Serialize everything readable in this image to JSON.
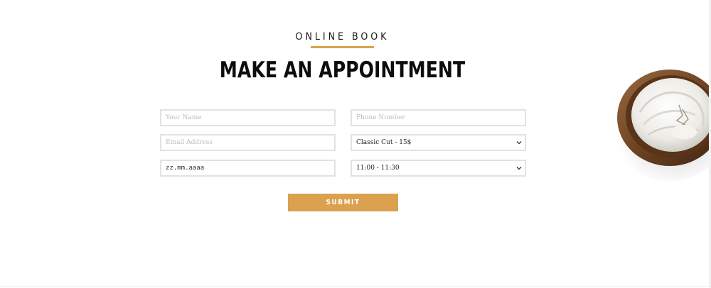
{
  "section": {
    "eyebrow": "ONLINE BOOK",
    "title": "MAKE AN APPOINTMENT"
  },
  "form": {
    "name_placeholder": "Your Name",
    "phone_placeholder": "Phone Number",
    "email_placeholder": "Email Address",
    "service_value": "Classic Cut - 15$",
    "date_value": "zz.mm.aaaa",
    "time_value": "11:00 - 11:30",
    "submit_label": "SUBMIT"
  },
  "colors": {
    "accent": "#dba14e",
    "field_border": "#e2e2e2",
    "title": "#0d0d0d"
  },
  "icons": {
    "select_arrow": "chevron-down-icon",
    "decor_image": "towel-bowl-image"
  }
}
